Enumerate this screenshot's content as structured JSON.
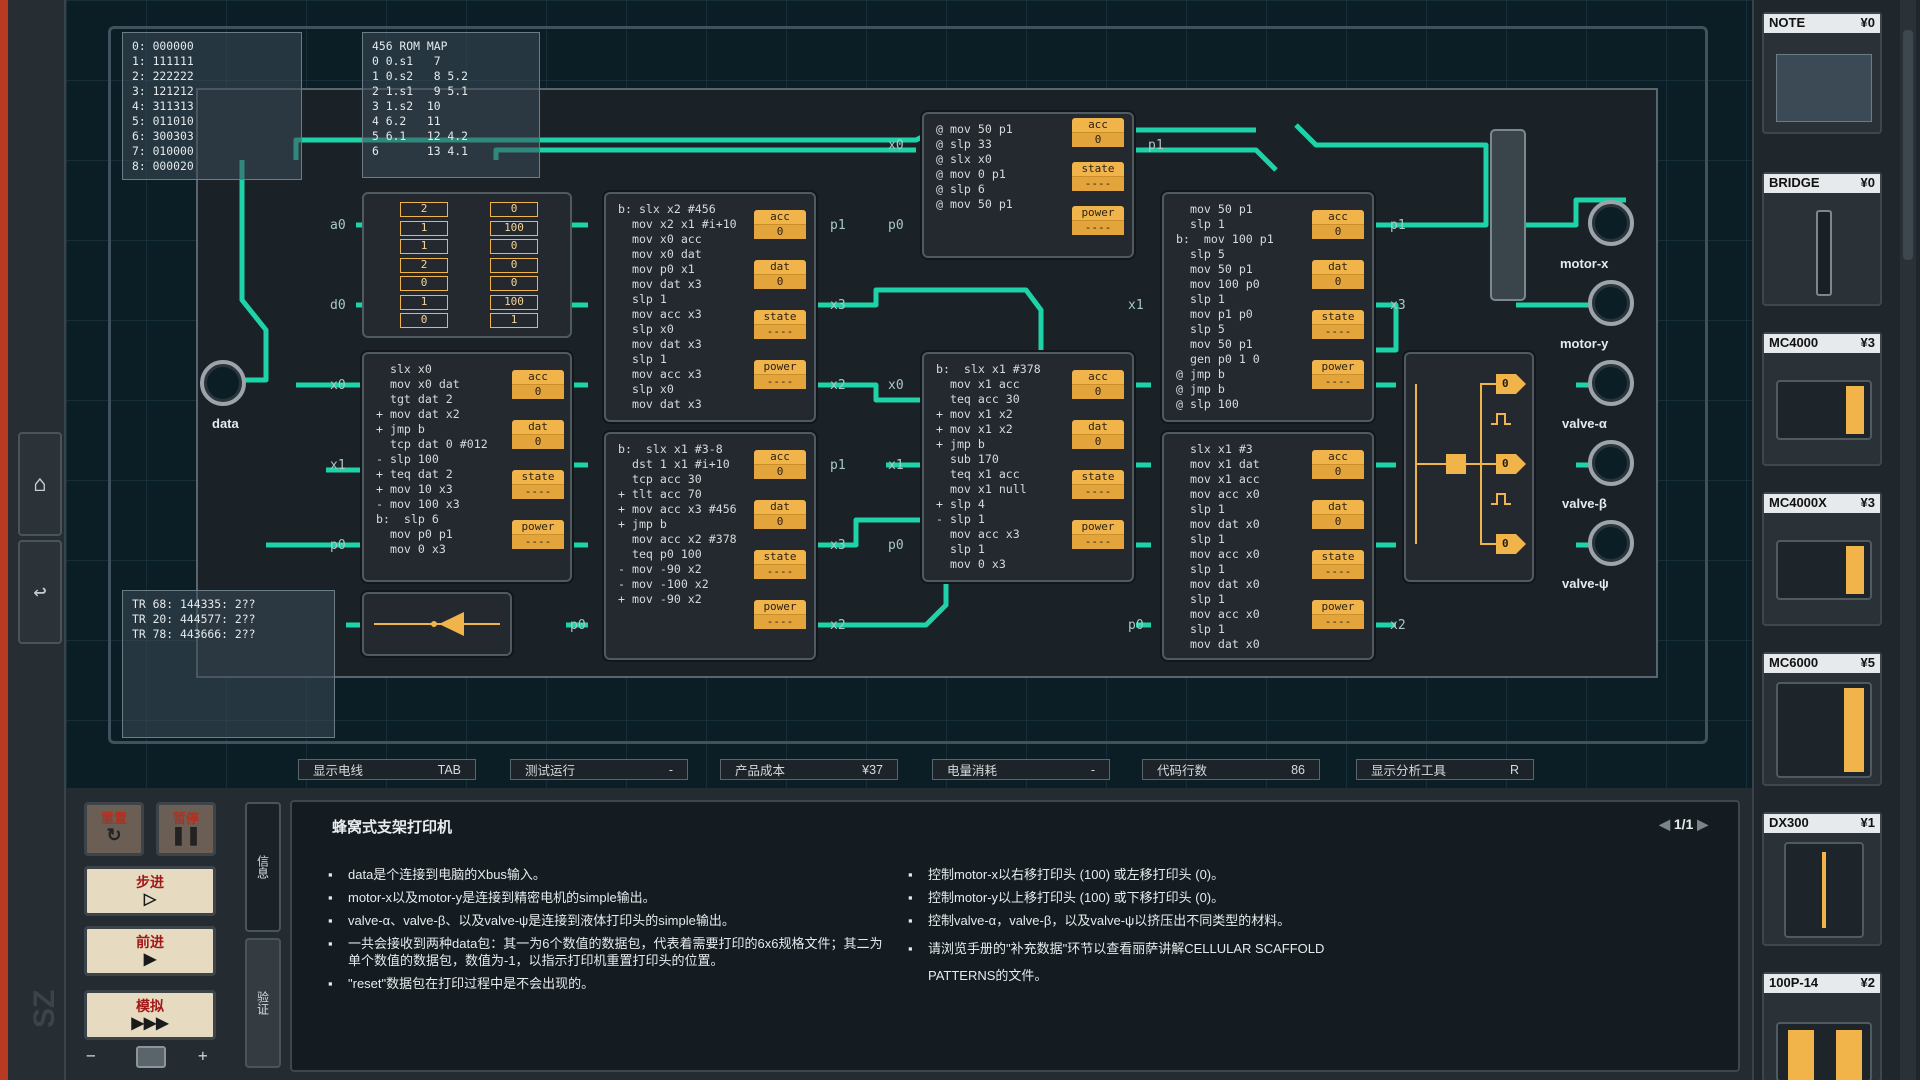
{
  "sidebar": {
    "home_icon": "home-icon",
    "back_icon": "undo-icon",
    "logo": "SZ"
  },
  "info_boxes": {
    "ram_listing": "0: 000000\n1: 111111\n2: 222222\n3: 121212\n4: 311313\n5: 011010\n6: 300303\n7: 010000\n8: 000020",
    "rom_map": "456 ROM MAP\n0 0.s1   7\n1 0.s2   8 5.2\n2 1.s1   9 5.1\n3 1.s2  10\n4 6.2   11\n5 6.1   12 4.2\n6       13 4.1",
    "trace": "TR 68: 144335: 2??\nTR 20: 444577: 2??\nTR 78: 443666: 2??"
  },
  "ram": {
    "left": [
      "2",
      "1",
      "1",
      "2",
      "0",
      "1",
      "0"
    ],
    "right": [
      "0",
      "100",
      "0",
      "0",
      "0",
      "100",
      "1"
    ]
  },
  "chips": {
    "c_data": "  slx x0\n  mov x0 dat\n  tgt dat 2\n+ mov dat x2\n+ jmp b\n  tcp dat 0 #012\n- slp 100\n+ teq dat 2\n+ mov 10 x3\n- mov 100 x3\nb:  slp 6\n  mov p0 p1\n  mov 0 x3",
    "c_mid_top": "b: slx x2 #456\n  mov x2 x1 #i+10\n  mov x0 acc\n  mov x0 dat\n  mov p0 x1\n  mov dat x3\n  slp 1\n  mov acc x3\n  slp x0\n  mov dat x3\n  slp 1\n  mov acc x3\n  slp x0\n  mov dat x3",
    "c_mid_bot": "b:  slx x1 #3-8\n  dst 1 x1 #i+10\n  tcp acc 30\n+ tlt acc 70\n+ mov acc x3 #456\n+ jmp b\n  mov acc x2 #378\n  teq p0 100\n- mov -90 x2\n- mov -100 x2\n+ mov -90 x2",
    "c_top": "@ mov 50 p1\n@ slp 33\n@ slx x0\n@ mov 0 p1\n@ slp 6\n@ mov 50 p1",
    "c_center": "b:  slx x1 #378\n  mov x1 acc\n  teq acc 30\n+ mov x1 x2\n+ mov x1 x2\n+ jmp b\n  sub 170\n  teq x1 acc\n  mov x1 null\n+ slp 4\n- slp 1\n  mov acc x3\n  slp 1\n  mov 0 x3",
    "c_right_top": "  mov 50 p1\n  slp 1\nb:  mov 100 p1\n  slp 5\n  mov 50 p1\n  mov 100 p0\n  slp 1\n  mov p1 p0\n  slp 5\n  mov 50 p1\n  gen p0 1 0\n@ jmp b\n@ jmp b\n@ slp 100",
    "c_right_bot": "  slx x1 #3\n  mov x1 dat\n  mov x1 acc\n  mov acc x0\n  slp 1\n  mov dat x0\n  slp 1\n  mov acc x0\n  slp 1\n  mov dat x0\n  slp 1\n  mov acc x0\n  slp 1\n  mov dat x0"
  },
  "reg_labels": {
    "acc": "acc",
    "dat": "dat",
    "state": "state",
    "power": "power",
    "zero": "0",
    "dash": "----"
  },
  "ports": {
    "data": "data",
    "motor_x": "motor-x",
    "motor_y": "motor-y",
    "valve_a": "valve-α",
    "valve_b": "valve-β",
    "valve_p": "valve-ψ"
  },
  "pins": {
    "x0": "x0",
    "x1": "x1",
    "x2": "x2",
    "x3": "x3",
    "p0": "p0",
    "p1": "p1",
    "a0": "a0",
    "d0": "d0"
  },
  "gate_outputs": [
    "0",
    "0",
    "0"
  ],
  "statusbar": [
    {
      "label": "显示电线",
      "value": "TAB"
    },
    {
      "label": "测试运行",
      "value": "-"
    },
    {
      "label": "产品成本",
      "value": "¥37"
    },
    {
      "label": "电量消耗",
      "value": "-"
    },
    {
      "label": "代码行数",
      "value": "86"
    },
    {
      "label": "显示分析工具",
      "value": "R"
    }
  ],
  "controls": {
    "reset": "重置",
    "pause": "暂停",
    "step": "步进",
    "step_g": "▷",
    "forward": "前进",
    "forward_g": "▶",
    "sim": "模拟",
    "sim_g": "▶▶▶",
    "minus": "−",
    "plus": "+"
  },
  "tabs": {
    "info": "信息",
    "verify": "验证"
  },
  "doc": {
    "title": "蜂窝式支架打印机",
    "page": "1/1",
    "left": [
      "data是个连接到电脑的Xbus输入。",
      "motor-x以及motor-y是连接到精密电机的simple输出。",
      "valve-α、valve-β、以及valve-ψ是连接到液体打印头的simple输出。",
      "一共会接收到两种data包：其一为6个数值的数据包，代表着需要打印的6x6规格文件；其二为单个数值的数据包，数值为-1，以指示打印机重置打印头的位置。",
      "\"reset\"数据包在打印过程中是不会出现的。"
    ],
    "right": [
      "控制motor-x以右移打印头 (100) 或左移打印头 (0)。",
      "控制motor-y以上移打印头 (100) 或下移打印头 (0)。",
      "控制valve-α，valve-β，以及valve-ψ以挤压出不同类型的材料。",
      "请浏览手册的\"补充数据\"环节以查看丽萨讲解CELLULAR SCAFFOLD PATTERNS的文件。"
    ]
  },
  "shop": [
    {
      "name": "NOTE",
      "price": "¥0"
    },
    {
      "name": "BRIDGE",
      "price": "¥0"
    },
    {
      "name": "MC4000",
      "price": "¥3"
    },
    {
      "name": "MC4000X",
      "price": "¥3"
    },
    {
      "name": "MC6000",
      "price": "¥5"
    },
    {
      "name": "DX300",
      "price": "¥1"
    },
    {
      "name": "100P-14",
      "price": "¥2"
    }
  ]
}
